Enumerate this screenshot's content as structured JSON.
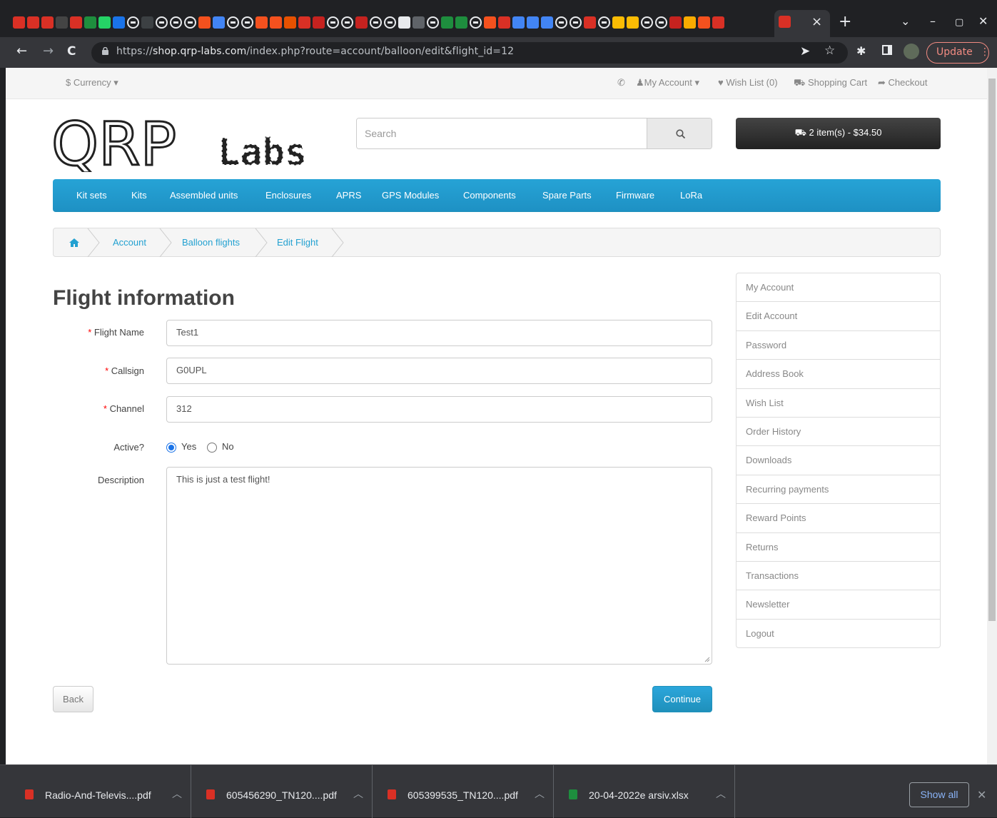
{
  "browser": {
    "url_prefix": "https://",
    "url_host": "shop.qrp-labs.com",
    "url_path": "/index.php?route=account/balloon/edit&flight_id=12",
    "update_label": "Update",
    "new_tab_label": "+",
    "tab_close_label": "×",
    "tab_favicon_colors": [
      "#d93025",
      "#d93025",
      "#d93025",
      "#444",
      "#d93025",
      "#1e8e3e",
      "#25d366",
      "#1a73e8",
      "#9aa0a6",
      "#3c4043",
      "#9aa0a6",
      "#9aa0a6",
      "#9aa0a6",
      "#f4511e",
      "#4285f4",
      "#9aa0a6",
      "#9aa0a6",
      "#f4511e",
      "#f4511e",
      "#e65100",
      "#d93025",
      "#c5221f",
      "#9aa0a6",
      "#9aa0a6",
      "#c5221f",
      "#9aa0a6",
      "#9aa0a6",
      "#e8eaed",
      "#5f6368",
      "#9aa0a6",
      "#1e8e3e",
      "#1e8e3e",
      "#9aa0a6",
      "#f4511e",
      "#d93025",
      "#4285f4",
      "#4285f4",
      "#4285f4",
      "#9aa0a6",
      "#9aa0a6",
      "#d93025",
      "#9aa0a6",
      "#fbbc04",
      "#fbbc04",
      "#9aa0a6",
      "#9aa0a6",
      "#c5221f",
      "#f9ab00",
      "#f4511e",
      "#d93025"
    ]
  },
  "topbar": {
    "currency": "Currency",
    "my_account": "My Account",
    "wish_list": "Wish List (0)",
    "shopping_cart": "Shopping Cart",
    "checkout": "Checkout"
  },
  "logo": {
    "text_left": "QRP",
    "text_right": "Labs"
  },
  "search": {
    "placeholder": "Search"
  },
  "cart": {
    "label": "2 item(s) - $34.50"
  },
  "menu": [
    "Kit sets",
    "Kits",
    "Assembled units",
    "Enclosures",
    "APRS",
    "GPS Modules",
    "Components",
    "Spare Parts",
    "Firmware",
    "LoRa"
  ],
  "breadcrumb": [
    "Account",
    "Balloon flights",
    "Edit Flight"
  ],
  "form": {
    "title": "Flight information",
    "flight_name_label": "Flight Name",
    "flight_name_value": "Test1",
    "callsign_label": "Callsign",
    "callsign_value": "G0UPL",
    "channel_label": "Channel",
    "channel_value": "312",
    "active_label": "Active?",
    "active_yes": "Yes",
    "active_no": "No",
    "active_selected": "Yes",
    "description_label": "Description",
    "description_value": "This is just a test flight!",
    "required_mark": "*",
    "back_label": "Back",
    "continue_label": "Continue"
  },
  "sidebar": [
    "My Account",
    "Edit Account",
    "Password",
    "Address Book",
    "Wish List",
    "Order History",
    "Downloads",
    "Recurring payments",
    "Reward Points",
    "Returns",
    "Transactions",
    "Newsletter",
    "Logout"
  ],
  "downloads": [
    {
      "name": "Radio-And-Televis....pdf",
      "type": "pdf"
    },
    {
      "name": "605456290_TN120....pdf",
      "type": "pdf"
    },
    {
      "name": "605399535_TN120....pdf",
      "type": "pdf"
    },
    {
      "name": "20-04-2022e arsiv.xlsx",
      "type": "xlsx"
    }
  ],
  "show_all_label": "Show all",
  "colors": {
    "accent": "#23a1d1",
    "menu_bg": "#229ac8",
    "required": "#ff0000",
    "pdf_icon": "#d93025",
    "xlsx_icon": "#1e8e3e"
  }
}
